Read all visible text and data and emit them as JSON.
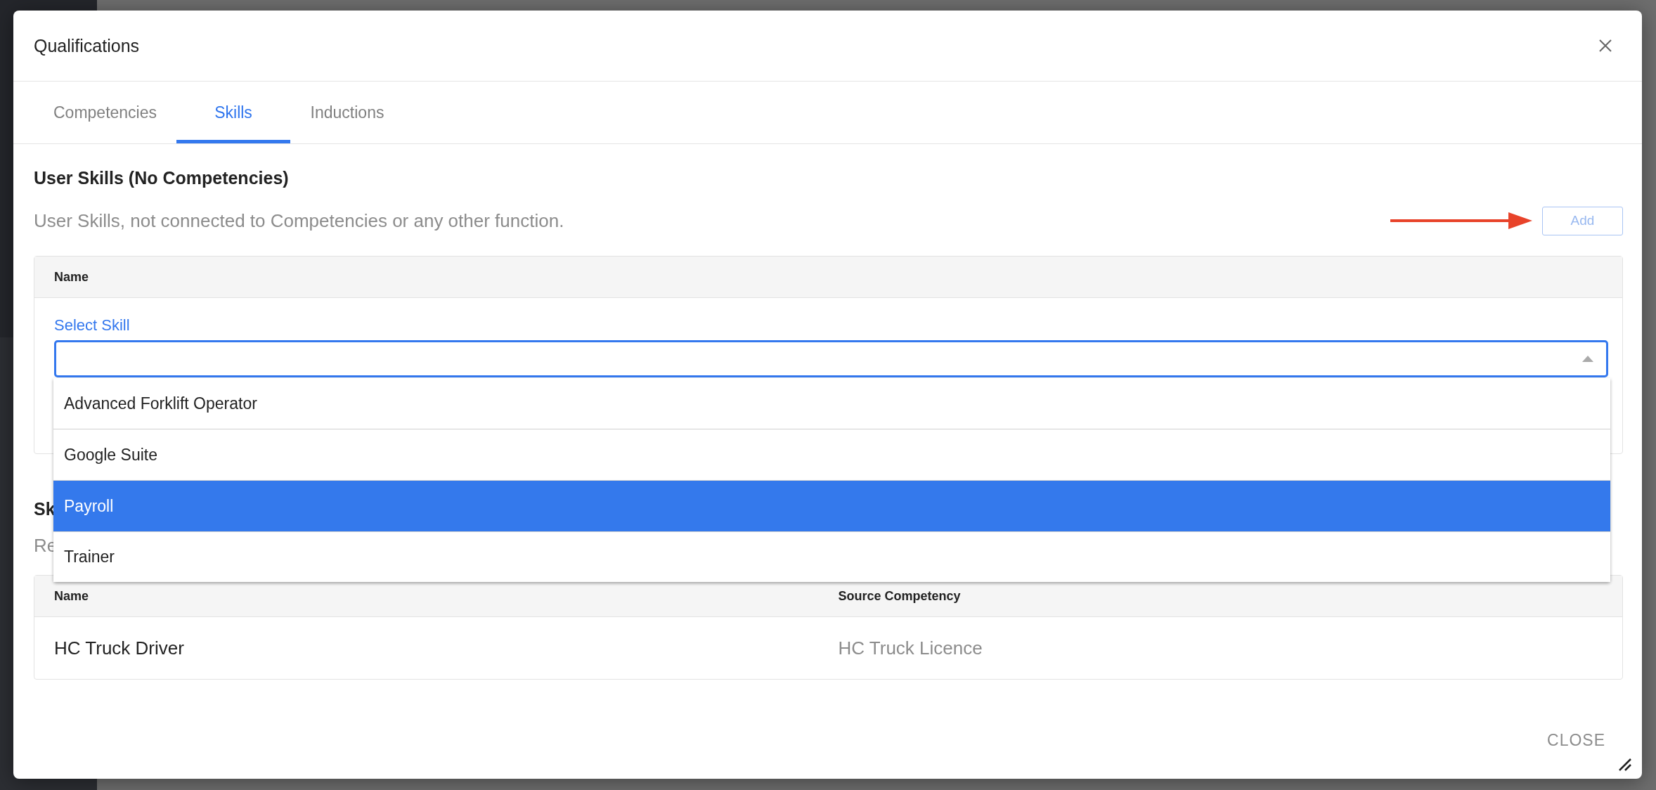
{
  "dialog": {
    "title": "Qualifications",
    "tabs": [
      {
        "label": "Competencies",
        "selected": false
      },
      {
        "label": "Skills",
        "selected": true
      },
      {
        "label": "Inductions",
        "selected": false
      }
    ],
    "user_skills": {
      "heading": "User Skills (No Competencies)",
      "description": "User Skills, not connected to Competencies or any other function.",
      "add_button": {
        "label": "Add",
        "disabled": true
      },
      "table": {
        "columns": [
          "Name"
        ]
      },
      "select": {
        "label": "Select Skill",
        "expanded": true,
        "options": [
          {
            "label": "Advanced Forklift Operator",
            "selected": false
          },
          {
            "label": "Google Suite",
            "selected": false
          },
          {
            "label": "Payroll",
            "selected": true
          },
          {
            "label": "Trainer",
            "selected": false
          }
        ]
      }
    },
    "competency_skills": {
      "heading": "Sk",
      "description": "Re",
      "table": {
        "columns": [
          "Name",
          "Source Competency"
        ],
        "rows": [
          [
            "HC Truck Driver",
            "HC Truck Licence"
          ]
        ]
      }
    },
    "footer": {
      "close_button": "CLOSE"
    }
  }
}
